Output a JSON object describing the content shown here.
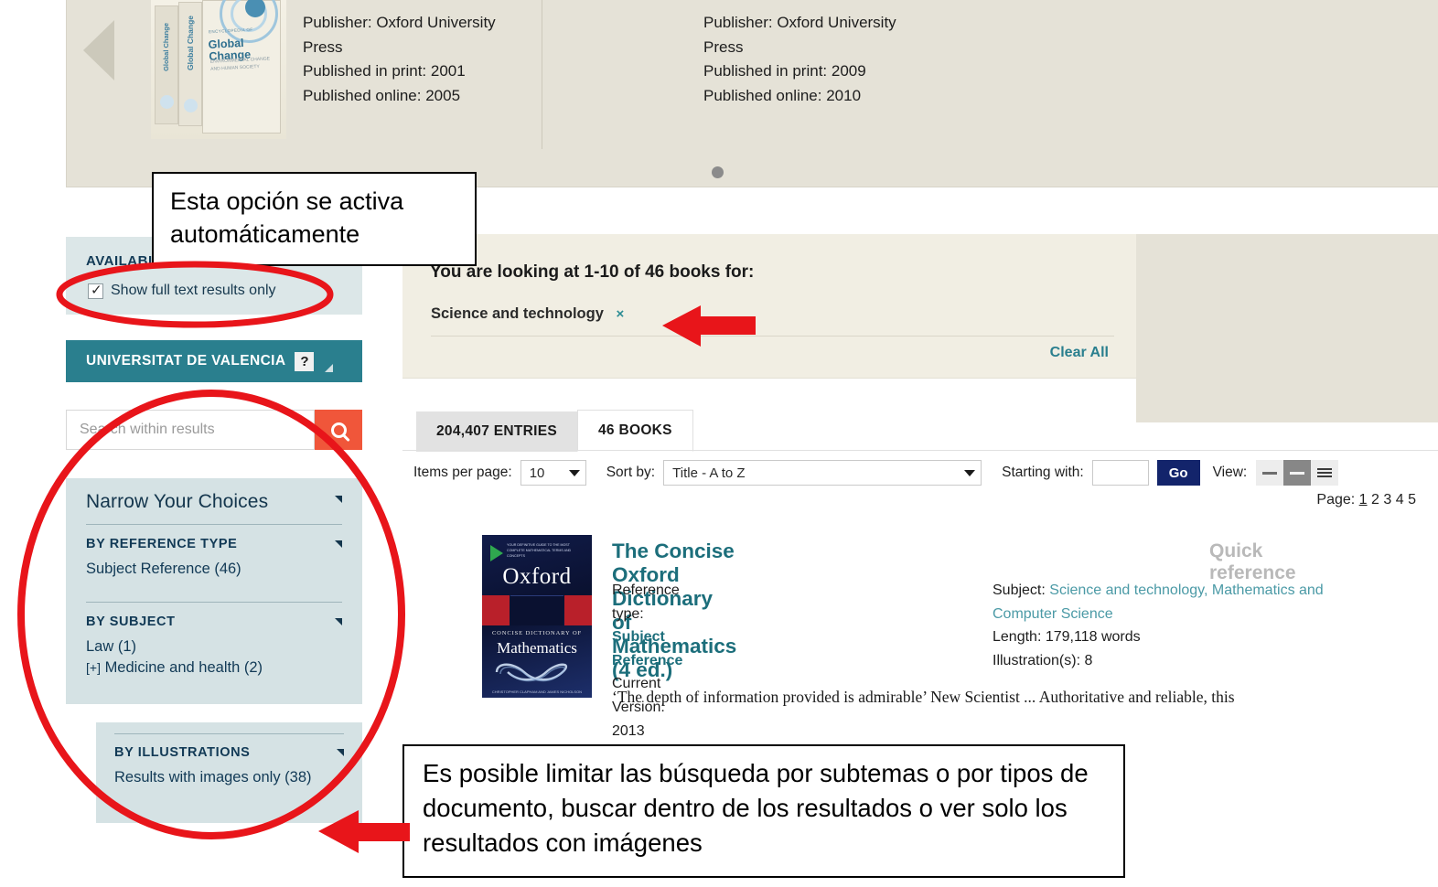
{
  "carousel": {
    "prev_icon": "prev-arrow-icon",
    "book1": {
      "cover_title": "Global Change",
      "cover_eyebrow": "ENCYCLOPEDIA OF",
      "cover_subtitle": "ENVIRONMENTAL CHANGE\nAND HUMAN SOCIETY",
      "spine_text": "Global Change"
    },
    "entries": [
      {
        "publisher_label": "Publisher: Oxford University",
        "publisher_cont": "Press",
        "print": "Published in print: 2001",
        "online": "Published online: 2005"
      },
      {
        "publisher_label": "Publisher: Oxford University",
        "publisher_cont": "Press",
        "print": "Published in print: 2009",
        "online": "Published online: 2010"
      }
    ],
    "dot_icon": "carousel-dot-icon"
  },
  "sidebar": {
    "availability": {
      "heading": "AVAILABILITY",
      "checkbox_label": "Show full text results only",
      "checkbox_checked": true
    },
    "institution_bar": {
      "name": "UNIVERSITAT DE VALENCIA",
      "help_glyph": "?",
      "caret_icon": "caret-down-icon"
    },
    "search": {
      "placeholder": "Search within results",
      "value": "",
      "button_icon": "search-icon"
    },
    "narrow": {
      "title": "Narrow Your Choices",
      "facets": [
        {
          "heading": "BY REFERENCE TYPE",
          "items": [
            {
              "label": "Subject Reference (46)",
              "expandable": false
            }
          ]
        },
        {
          "heading": "BY SUBJECT",
          "items": [
            {
              "label": "Law (1)",
              "expandable": false
            },
            {
              "label": "Medicine and health (2)",
              "expandable": true,
              "expand_glyph": "[+]"
            }
          ]
        }
      ]
    },
    "illustrations": {
      "heading": "BY ILLUSTRATIONS",
      "item": "Results with images only (38)"
    }
  },
  "results_header": {
    "title": "You are looking at  1-10 of 46 books for:",
    "term": "Science and technology",
    "term_remove_glyph": "×",
    "clear_all": "Clear All"
  },
  "tabs": [
    {
      "label": "204,407 ENTRIES",
      "active": false
    },
    {
      "label": "46 BOOKS",
      "active": true
    }
  ],
  "toolbar": {
    "items_per_page_label": "Items per page:",
    "items_per_page_value": "10",
    "sort_by_label": "Sort by:",
    "sort_by_value": "Title - A to Z",
    "starting_with_label": "Starting with:",
    "starting_with_value": "",
    "go_label": "Go",
    "view_label": "View:",
    "view_options": [
      "compact-view-icon",
      "medium-view-icon",
      "list-view-icon"
    ],
    "view_selected_index": 1
  },
  "pagination": {
    "label": "Page:",
    "pages": [
      "1",
      "2",
      "3",
      "4",
      "5"
    ],
    "current": "1"
  },
  "result": {
    "title": "The Concise Oxford Dictionary of Mathematics (4 ed.)",
    "badge": "Quick reference",
    "cover": {
      "brand": "Oxford",
      "kicker": "YOUR DEFINITIVE GUIDE TO THE MOST COMPLETE MATHEMATICAL TERMS AND CONCEPTS",
      "series": "CONCISE DICTIONARY OF",
      "subject": "Mathematics",
      "authors": "CHRISTOPHER CLAPHAM AND JAMES NICHOLSON"
    },
    "left_fields": [
      {
        "label": "Reference type:",
        "value": "Subject Reference",
        "emphasis": true
      },
      {
        "label": "Current Version:",
        "value": "2013",
        "emphasis": false
      }
    ],
    "right_fields": [
      {
        "label": "Subject:",
        "value": "Science and technology, Mathematics and Computer Science",
        "link": true
      },
      {
        "label": "Length:",
        "value": "179,118 words",
        "link": false
      },
      {
        "label": "Illustration(s):",
        "value": "8",
        "link": false
      }
    ],
    "quote": "‘The depth of information provided is admirable’ New Scientist ... Authoritative and reliable, this"
  },
  "annotations": {
    "note1": "Esta opción se activa automáticamente",
    "note2": "Es posible limitar las búsqueda por subtemas o por tipos de documento, buscar dentro de los resultados o ver solo los resultados con imágenes",
    "highlight_color": "#e8151a"
  }
}
